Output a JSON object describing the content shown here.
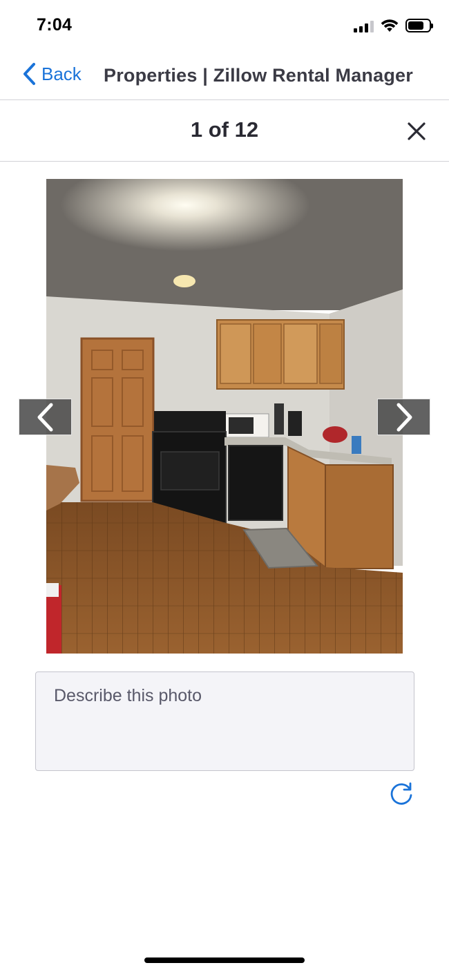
{
  "status_bar": {
    "time": "7:04",
    "icons": [
      "cellular-signal-icon",
      "wifi-icon",
      "battery-icon"
    ]
  },
  "nav": {
    "back_label": "Back",
    "title": "Properties | Zillow Rental Manager",
    "accent_color": "#1a73d9"
  },
  "viewer": {
    "counter": "1 of 12",
    "close_icon": "close-icon",
    "prev_icon": "chevron-left-icon",
    "next_icon": "chevron-right-icon",
    "photo_subject": "kitchen-photo"
  },
  "description": {
    "placeholder": "Describe this photo",
    "value": ""
  },
  "actions": {
    "refresh_icon": "refresh-icon"
  }
}
